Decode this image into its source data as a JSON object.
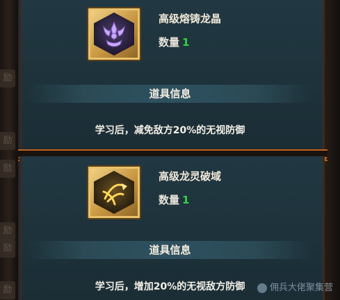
{
  "left_tabs": [
    "励",
    "励",
    "励",
    "励",
    "励",
    "励"
  ],
  "item1": {
    "name": "高级熔铸龙晶",
    "quantity_label": "数量",
    "quantity": "1",
    "icon": "purple-dragon-crystal-icon",
    "section_title": "道具信息",
    "description": "学习后，减免敌方20%的无视防御"
  },
  "item2": {
    "name": "高级龙灵破域",
    "quantity_label": "数量",
    "quantity": "1",
    "icon": "gold-dragon-spirit-icon",
    "section_title": "道具信息",
    "description": "学习后，增加20%的无视敌方防御"
  },
  "watermark": "佣兵大佬聚集营",
  "colors": {
    "quantity_number": "#35d440",
    "border_accent": "#c0601e",
    "icon_frame": "#d4a24c"
  }
}
